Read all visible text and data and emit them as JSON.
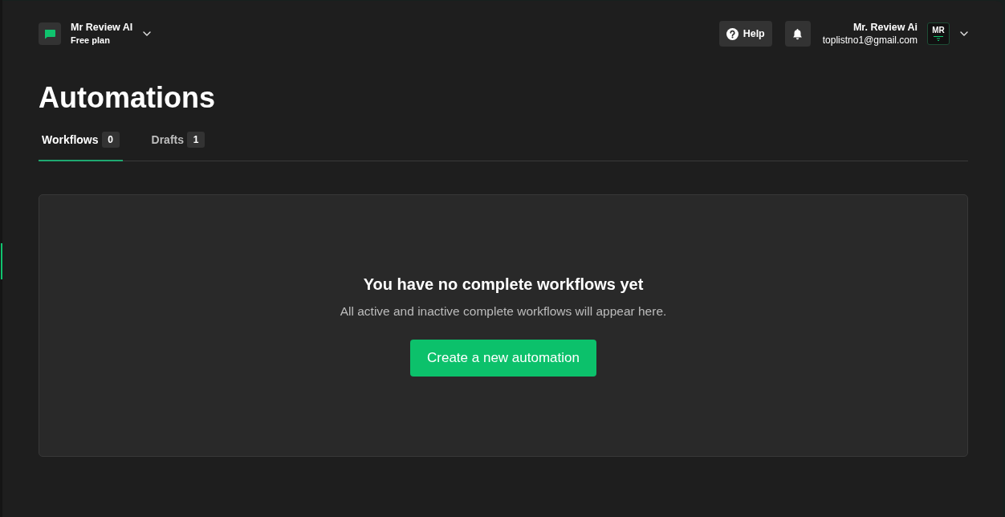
{
  "workspace": {
    "name": "Mr Review AI",
    "plan": "Free plan"
  },
  "header": {
    "help_label": "Help",
    "user": {
      "name": "Mr. Review Ai",
      "email": "toplistno1@gmail.com",
      "avatar_initials": "MR"
    }
  },
  "page_title": "Automations",
  "tabs": [
    {
      "label": "Workflows",
      "count": "0",
      "selected": true
    },
    {
      "label": "Drafts",
      "count": "1",
      "selected": false
    }
  ],
  "empty_state": {
    "title": "You have no complete workflows yet",
    "description": "All active and inactive complete workflows will appear here.",
    "button": "Create a new automation"
  }
}
